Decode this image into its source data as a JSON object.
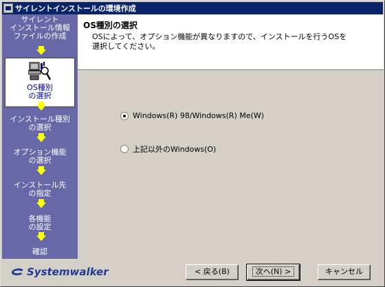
{
  "window": {
    "title": "サイレントインストールの環境作成"
  },
  "sidebar": {
    "steps": [
      {
        "label": "サイレント\nインストール情報\nファイルの作成"
      },
      {
        "label": "OS種別\nの選択"
      },
      {
        "label": "インストール種別\nの選択"
      },
      {
        "label": "オプション機能\nの選択"
      },
      {
        "label": "インストール先\nの指定"
      },
      {
        "label": "各機能\nの設定"
      },
      {
        "label": "確認"
      }
    ]
  },
  "header": {
    "title": "OS種別の選択",
    "description": "OSによって、オプション機能が異なりますので、インストールを行うOSを\n選択してください。"
  },
  "options": [
    {
      "label": "Windows(R) 98/Windows(R) Me(W)",
      "selected": true
    },
    {
      "label": "上記以外のWindows(O)",
      "selected": false
    }
  ],
  "footer": {
    "brand": "Systemwalker",
    "back_label": "< 戻る(B)",
    "next_label": "次へ(N) >",
    "cancel_label": "キャンセル"
  }
}
